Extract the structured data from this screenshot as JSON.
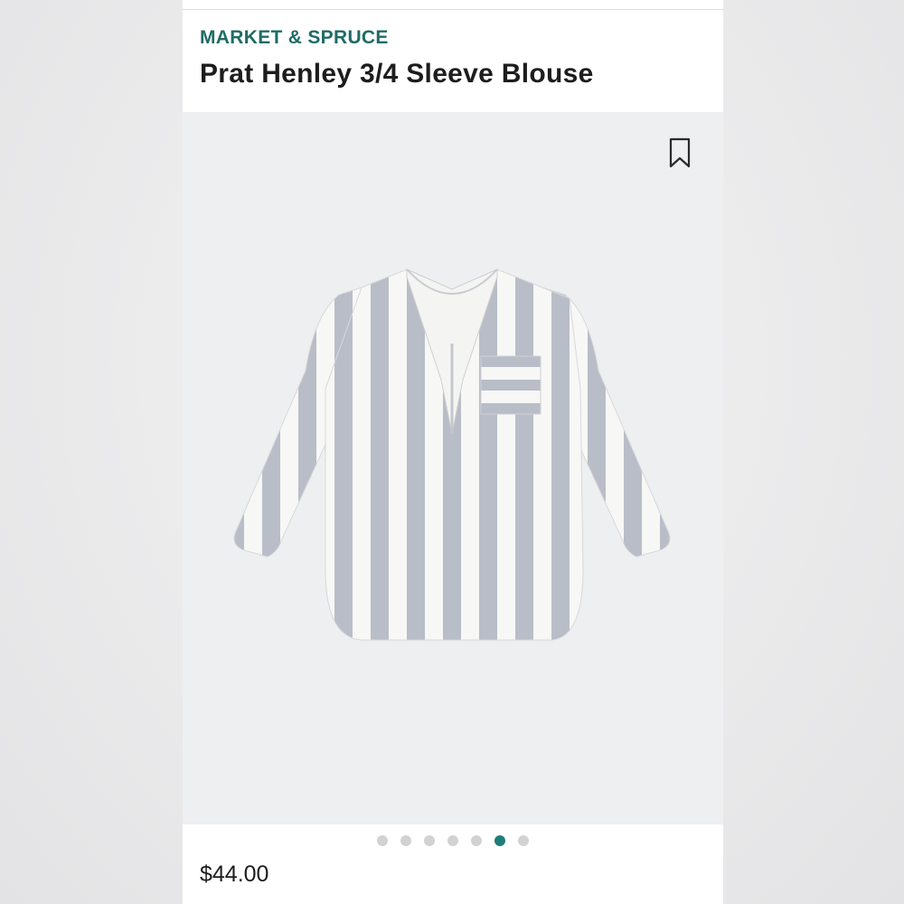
{
  "product": {
    "brand": "MARKET & SPRUCE",
    "title": "Prat Henley 3/4 Sleeve Blouse",
    "price": "$44.00"
  },
  "gallery": {
    "dot_count": 7,
    "active_index": 5
  },
  "icons": {
    "bookmark": "bookmark-icon"
  },
  "colors": {
    "brand": "#1f6b66",
    "active_dot": "#1f7d78",
    "inactive_dot": "#d2d2d2",
    "image_bg": "#eeeff1",
    "stripe": "#b9bdc7"
  }
}
